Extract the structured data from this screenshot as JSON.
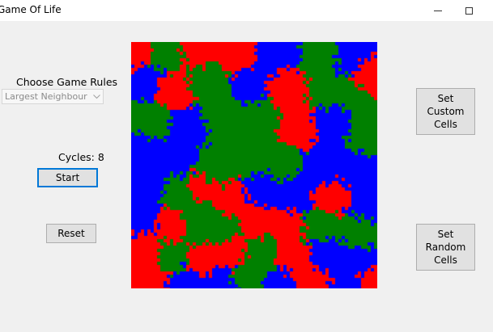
{
  "window": {
    "title": "Game Of Life"
  },
  "controls": {
    "rules_label": "Choose Game Rules",
    "rules_selected": "Largest Neighbour",
    "cycles_label": "Cycles: 8",
    "start_label": "Start",
    "reset_label": "Reset",
    "custom_label_1": "Set",
    "custom_label_2": "Custom",
    "custom_label_3": "Cells",
    "random_label_1": "Set",
    "random_label_2": "Random",
    "random_label_3": "Cells"
  },
  "board": {
    "colors": [
      "#ff0000",
      "#008000",
      "#0000ff"
    ]
  }
}
